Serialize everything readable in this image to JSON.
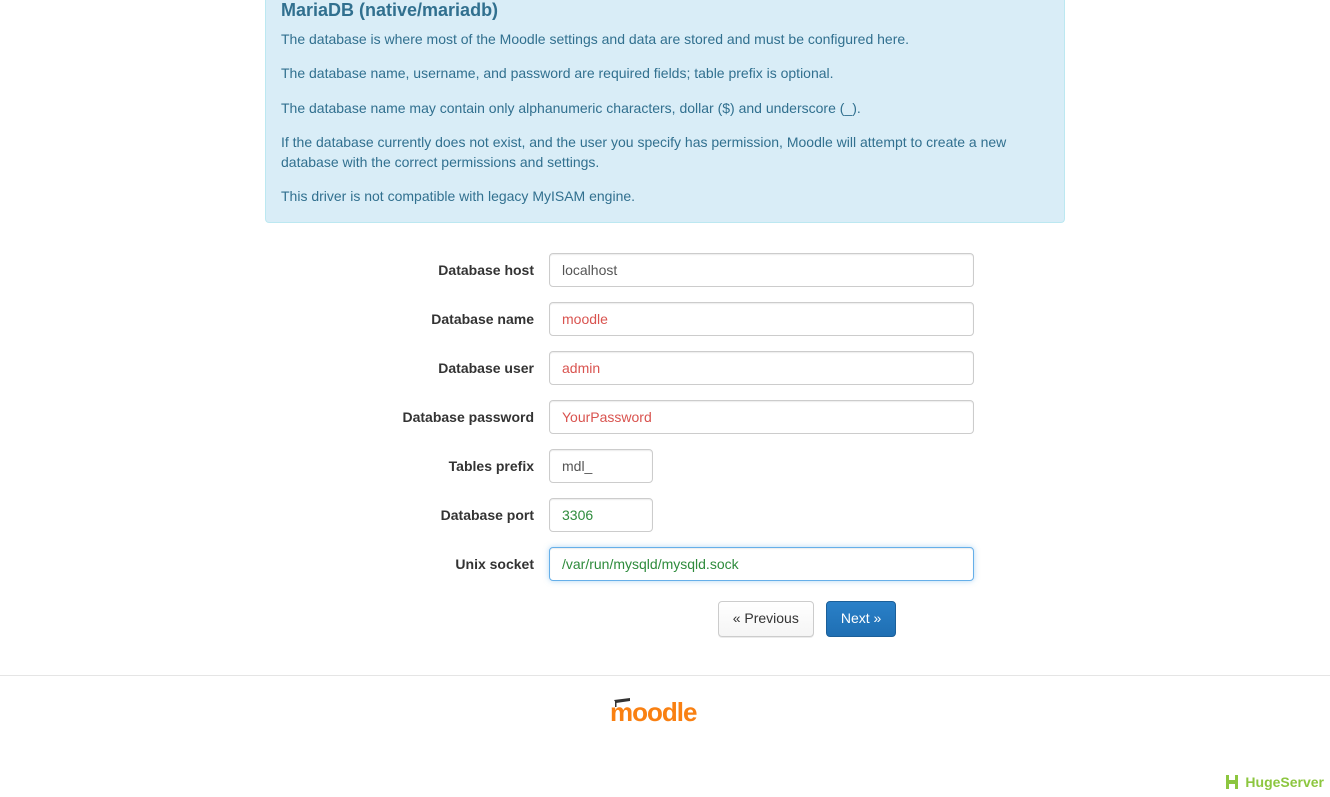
{
  "info": {
    "heading": "MariaDB (native/mariadb)",
    "p1": "The database is where most of the Moodle settings and data are stored and must be configured here.",
    "p2": "The database name, username, and password are required fields; table prefix is optional.",
    "p3": "The database name may contain only alphanumeric characters, dollar ($) and underscore (_).",
    "p4": "If the database currently does not exist, and the user you specify has permission, Moodle will attempt to create a new database with the correct permissions and settings.",
    "p5": "This driver is not compatible with legacy MyISAM engine."
  },
  "labels": {
    "dbhost": "Database host",
    "dbname": "Database name",
    "dbuser": "Database user",
    "dbpass": "Database password",
    "prefix": "Tables prefix",
    "dbport": "Database port",
    "socket": "Unix socket"
  },
  "values": {
    "dbhost": "localhost",
    "dbname": "moodle",
    "dbuser": "admin",
    "dbpass": "YourPassword",
    "prefix": "mdl_",
    "dbport": "3306",
    "socket": "/var/run/mysqld/mysqld.sock"
  },
  "buttons": {
    "previous": "« Previous",
    "next": "Next »"
  },
  "footer": {
    "logo_text": "moodle",
    "hugeserver": "HugeServer"
  }
}
